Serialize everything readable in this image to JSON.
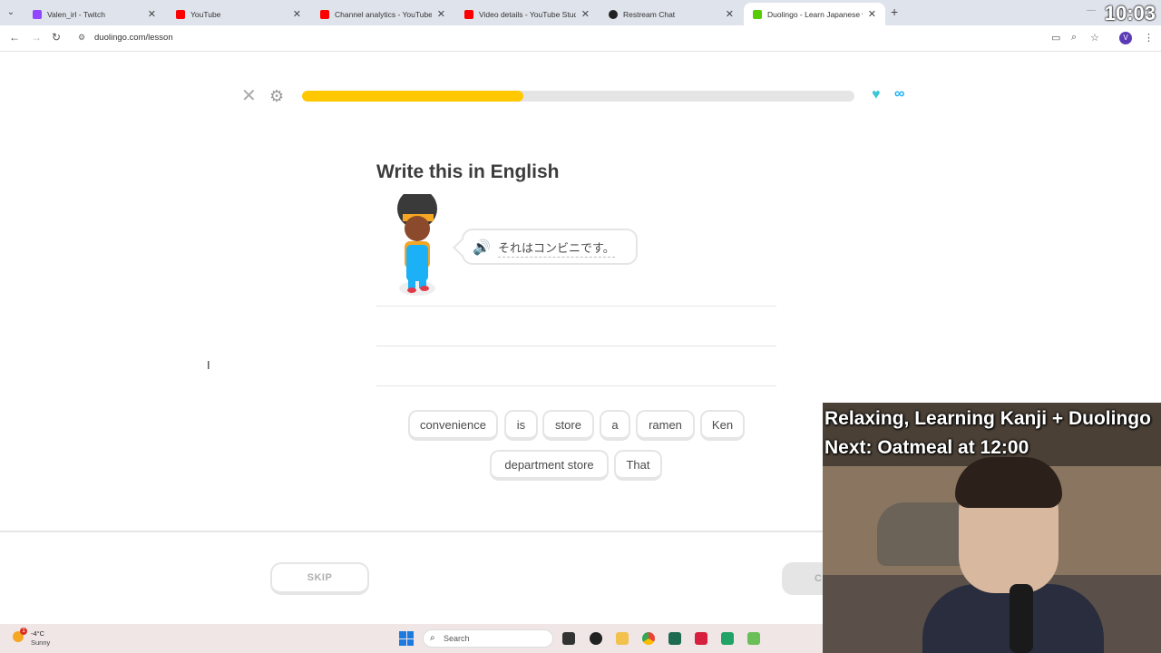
{
  "browser": {
    "tabs": [
      {
        "title": "Valen_irl - Twitch",
        "icon": "twitch-icon",
        "color": "#9146ff",
        "active": false
      },
      {
        "title": "YouTube",
        "icon": "youtube-icon",
        "color": "#ff0000",
        "active": false
      },
      {
        "title": "Channel analytics - YouTube Stu",
        "icon": "youtube-studio-icon",
        "color": "#ff0000",
        "active": false
      },
      {
        "title": "Video details - YouTube Studio",
        "icon": "youtube-studio-icon",
        "color": "#ff0000",
        "active": false
      },
      {
        "title": "Restream Chat",
        "icon": "restream-icon",
        "color": "#222222",
        "active": false
      },
      {
        "title": "Duolingo - Learn Japanese with",
        "icon": "duolingo-icon",
        "color": "#58cc02",
        "active": true
      }
    ],
    "url": "duolingo.com/lesson",
    "profile_initial": "V"
  },
  "stream_clock": "10:03",
  "lesson": {
    "progress": 0.4,
    "hearts": "∞",
    "prompt": "Write this in English",
    "sentence_jp": "それはコンビニです。",
    "word_bank": [
      "convenience",
      "is",
      "store",
      "a",
      "ramen",
      "Ken",
      "department store",
      "That"
    ],
    "skip_label": "SKIP",
    "check_label": "C"
  },
  "taskbar": {
    "temperature": "-4°C",
    "condition": "Sunny",
    "weather_badge": "1",
    "search_placeholder": "Search"
  },
  "overlay": {
    "title": "Relaxing, Learning Kanji + Duolingo",
    "next": "Next: Oatmeal at 12:00"
  },
  "colors": {
    "progress": "#ffc800",
    "accent_blue": "#1cb0f6",
    "border": "#e5e5e5"
  }
}
